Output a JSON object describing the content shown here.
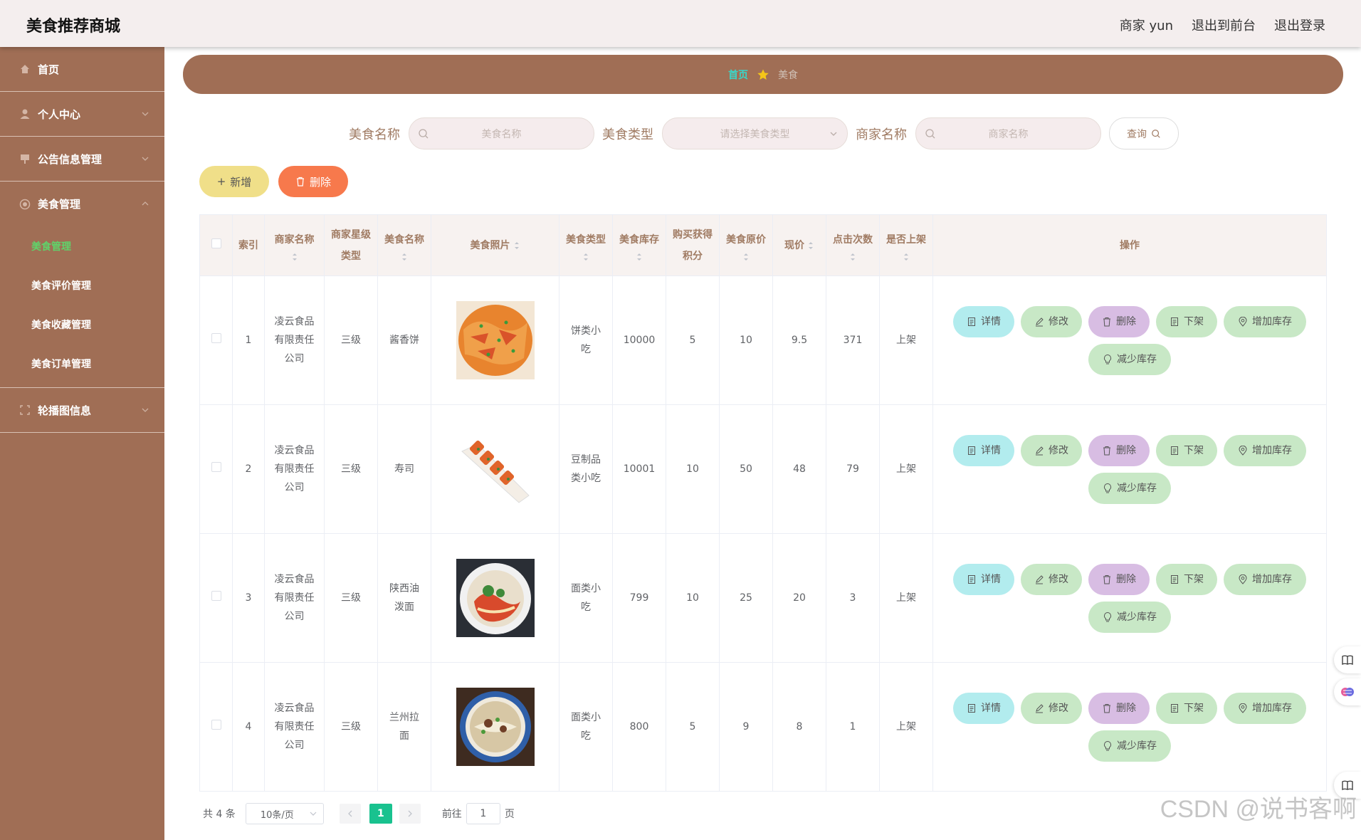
{
  "header": {
    "title": "美食推荐商城",
    "user_label": "商家 yun",
    "to_front_label": "退出到前台",
    "logout_label": "退出登录"
  },
  "sidebar": {
    "items": [
      {
        "label": "首页",
        "icon": "home-icon"
      },
      {
        "label": "个人中心",
        "icon": "user-icon"
      },
      {
        "label": "公告信息管理",
        "icon": "notice-icon"
      },
      {
        "label": "美食管理",
        "icon": "food-icon"
      },
      {
        "label": "轮播图信息",
        "icon": "carousel-icon"
      }
    ],
    "sub_items": [
      "美食管理",
      "美食评价管理",
      "美食收藏管理",
      "美食订单管理"
    ]
  },
  "breadcrumb": {
    "home": "首页",
    "current": "美食"
  },
  "search": {
    "food_name_label": "美食名称",
    "food_name_placeholder": "美食名称",
    "food_type_label": "美食类型",
    "food_type_placeholder": "请选择美食类型",
    "merchant_label": "商家名称",
    "merchant_placeholder": "商家名称",
    "query_label": "查询"
  },
  "toolbar": {
    "add_label": "新增",
    "delete_label": "删除"
  },
  "table": {
    "columns": [
      "索引",
      "商家名称",
      "商家星级类型",
      "美食名称",
      "美食照片",
      "美食类型",
      "美食库存",
      "购买获得积分",
      "美食原价",
      "现价",
      "点击次数",
      "是否上架",
      "操作"
    ],
    "rows": [
      {
        "index": "1",
        "merchant": "凌云食品有限责任公司",
        "star": "三级",
        "name": "酱香饼",
        "type": "饼类小吃",
        "stock": "10000",
        "points": "5",
        "orig_price": "10",
        "price": "9.5",
        "clicks": "371",
        "status": "上架"
      },
      {
        "index": "2",
        "merchant": "凌云食品有限责任公司",
        "star": "三级",
        "name": "寿司",
        "type": "豆制品类小吃",
        "stock": "10001",
        "points": "10",
        "orig_price": "50",
        "price": "48",
        "clicks": "79",
        "status": "上架"
      },
      {
        "index": "3",
        "merchant": "凌云食品有限责任公司",
        "star": "三级",
        "name": "陕西油泼面",
        "type": "面类小吃",
        "stock": "799",
        "points": "10",
        "orig_price": "25",
        "price": "20",
        "clicks": "3",
        "status": "上架"
      },
      {
        "index": "4",
        "merchant": "凌云食品有限责任公司",
        "star": "三级",
        "name": "兰州拉面",
        "type": "面类小吃",
        "stock": "800",
        "points": "5",
        "orig_price": "9",
        "price": "8",
        "clicks": "1",
        "status": "上架"
      }
    ],
    "actions": {
      "detail": "详情",
      "edit": "修改",
      "delete": "删除",
      "off_shelf": "下架",
      "add_stock": "增加库存",
      "reduce_stock": "减少库存"
    }
  },
  "pagination": {
    "total": "共 4 条",
    "page_size": "10条/页",
    "current_page": "1",
    "goto_prefix": "前往",
    "goto_value": "1",
    "goto_suffix": "页"
  },
  "watermark": "CSDN @说书客啊"
}
